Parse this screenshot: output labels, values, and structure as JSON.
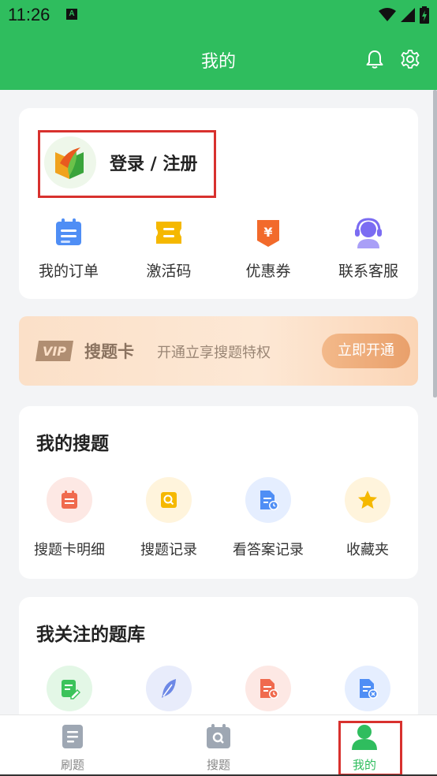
{
  "status_bar": {
    "time": "11:26",
    "badge": "A"
  },
  "header": {
    "title": "我的",
    "bell_icon": "bell-icon",
    "gear_icon": "gear-icon"
  },
  "login": {
    "text": "登录 / 注册"
  },
  "quick_actions": [
    {
      "label": "我的订单",
      "icon": "order-clipboard-icon",
      "color": "#4f8ef5"
    },
    {
      "label": "激活码",
      "icon": "ticket-icon",
      "color": "#f5b800"
    },
    {
      "label": "优惠券",
      "icon": "coupon-yen-icon",
      "color": "#f26a2b"
    },
    {
      "label": "联系客服",
      "icon": "headset-support-icon",
      "color": "#7b6cf2"
    }
  ],
  "vip": {
    "badge": "VIP",
    "title": "搜题卡",
    "desc": "开通立享搜题特权",
    "button": "立即开通"
  },
  "my_search": {
    "title": "我的搜题",
    "items": [
      {
        "label": "搜题卡明细",
        "icon": "list-note-icon"
      },
      {
        "label": "搜题记录",
        "icon": "search-record-icon"
      },
      {
        "label": "看答案记录",
        "icon": "answer-history-icon"
      },
      {
        "label": "收藏夹",
        "icon": "star-icon"
      }
    ]
  },
  "followed_banks": {
    "title": "我关注的题库",
    "items": [
      {
        "icon": "edit-doc-icon"
      },
      {
        "icon": "feather-icon"
      },
      {
        "icon": "doc-clock-icon"
      },
      {
        "icon": "doc-remove-icon"
      }
    ]
  },
  "tabbar": {
    "items": [
      {
        "label": "刷题",
        "icon": "practice-doc-icon",
        "active": false
      },
      {
        "label": "搜题",
        "icon": "search-doc-icon",
        "active": false
      },
      {
        "label": "我的",
        "icon": "user-icon",
        "active": true
      }
    ]
  },
  "colors": {
    "brand_green": "#2fbd5e",
    "highlight_red": "#d8312e"
  }
}
